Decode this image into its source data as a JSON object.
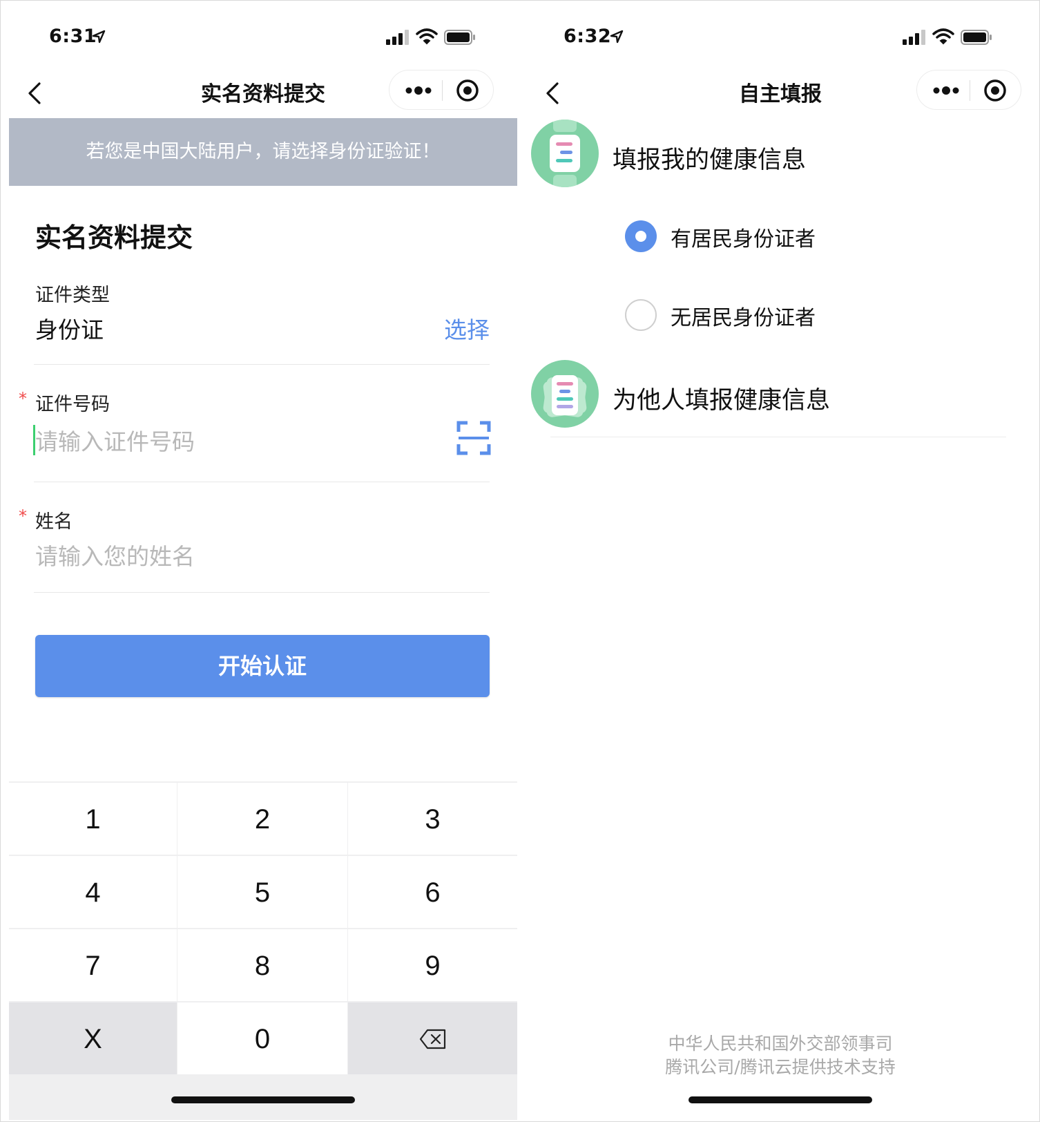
{
  "left_screen": {
    "status": {
      "time": "6:31"
    },
    "nav": {
      "title": "实名资料提交"
    },
    "banner": "若您是中国大陆用户，请选择身份证验证！",
    "form_title": "实名资料提交",
    "id_type": {
      "label": "证件类型",
      "value": "身份证",
      "action": "选择"
    },
    "id_number": {
      "required_mark": "*",
      "label": "证件号码",
      "placeholder": "请输入证件号码"
    },
    "name": {
      "required_mark": "*",
      "label": "姓名",
      "placeholder": "请输入您的姓名"
    },
    "submit_label": "开始认证",
    "keyboard": {
      "keys": [
        "1",
        "2",
        "3",
        "4",
        "5",
        "6",
        "7",
        "8",
        "9",
        "X",
        "0"
      ]
    }
  },
  "right_screen": {
    "status": {
      "time": "6:32"
    },
    "nav": {
      "title": "自主填报"
    },
    "self_report": {
      "title": "填报我的健康信息",
      "icon": "health-document-icon"
    },
    "options": [
      {
        "label": "有居民身份证者",
        "selected": true
      },
      {
        "label": "无居民身份证者",
        "selected": false
      }
    ],
    "other_report": {
      "title": "为他人填报健康信息",
      "icon": "health-documents-stack-icon"
    },
    "footer": {
      "line1": "中华人民共和国外交部领事司",
      "line2": "腾讯公司/腾讯云提供技术支持"
    }
  },
  "colors": {
    "accent_blue": "#5b8fea",
    "banner_gray": "#b2b9c6",
    "icon_green": "#80d1a5",
    "required_red": "#f04b4b"
  }
}
